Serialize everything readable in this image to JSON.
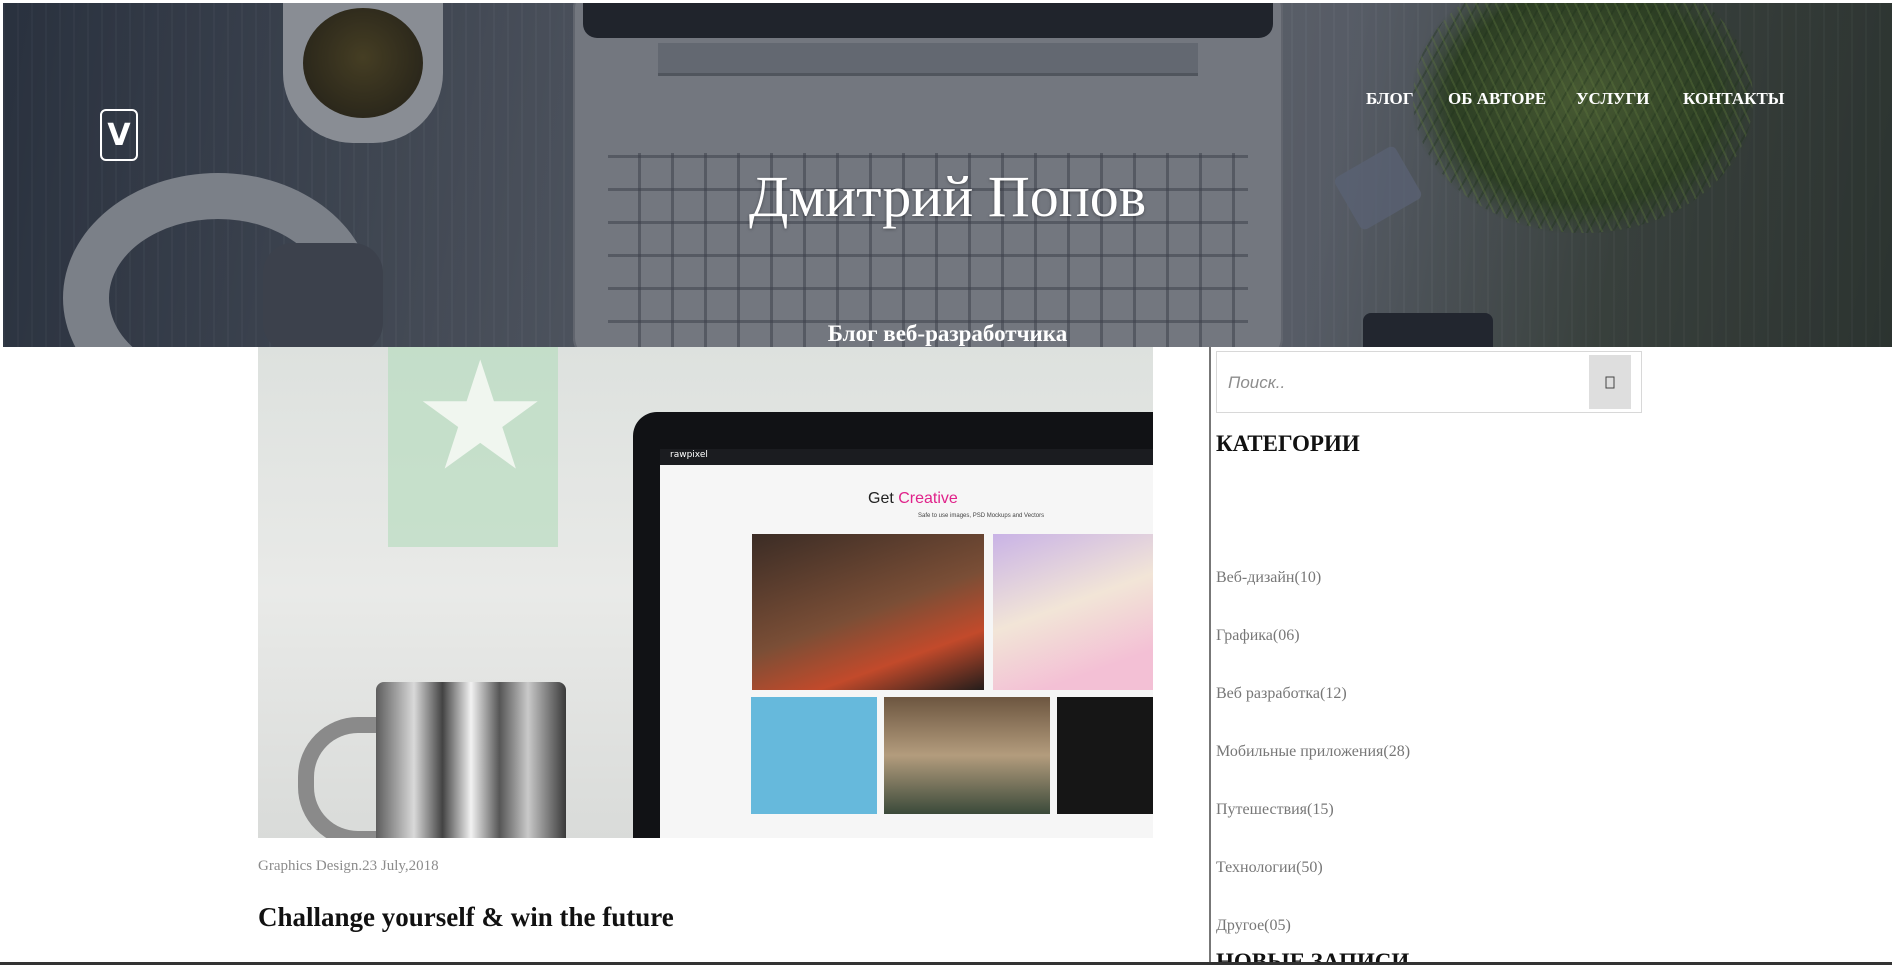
{
  "header": {
    "logo_letter": "V",
    "site_title": "Дмитрий Попов",
    "site_subtitle": "Блог веб-разработчика",
    "nav": [
      {
        "label": "БЛОГ"
      },
      {
        "label": "ОБ АВТОРЕ"
      },
      {
        "label": "УСЛУГИ"
      },
      {
        "label": "КОНТАКТЫ"
      }
    ]
  },
  "post": {
    "image_screen": {
      "brand": "rawpixel",
      "headline_prefix": "Get ",
      "headline_accent": "Creative",
      "subline": "Safe to use images, PSD Mockups and Vectors"
    },
    "meta": "Graphics Design.23 July,2018",
    "title": "Challange yourself & win the future"
  },
  "sidebar": {
    "search": {
      "placeholder": "Поиск..",
      "icon": "search-icon"
    },
    "categories_heading": "КАТЕГОРИИ",
    "categories": [
      {
        "label": "Веб-дизайн(10)"
      },
      {
        "label": "Графика(06)"
      },
      {
        "label": "Веб разработка(12)"
      },
      {
        "label": "Мобильные приложения(28)"
      },
      {
        "label": "Путешествия(15)"
      },
      {
        "label": "Технологии(50)"
      },
      {
        "label": "Другое(05)"
      }
    ],
    "next_heading": "НОВЫЕ ЗАПИСИ"
  },
  "colors": {
    "hero_overlay": "#121926",
    "sidebar_text": "#777777",
    "meta_text": "#8c8c8c",
    "screen_accent": "#e0228a"
  }
}
